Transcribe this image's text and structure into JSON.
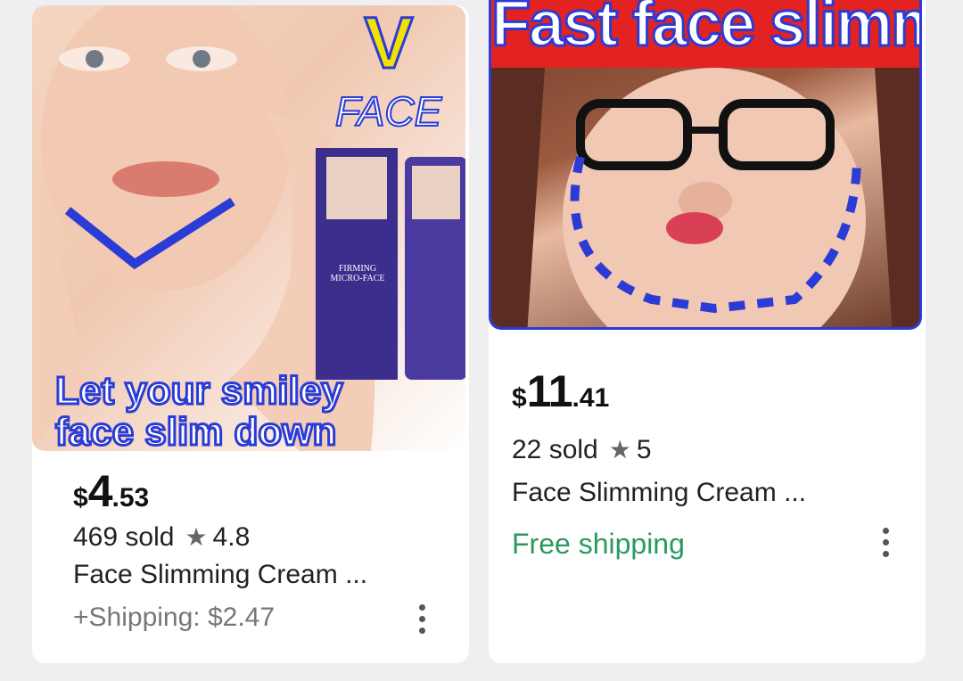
{
  "products": [
    {
      "image_text": {
        "letter": "V",
        "word": "FACE",
        "tagline_line1": "Let your smiley",
        "tagline_line2": "face slim down",
        "box_line1": "FIRMING",
        "box_line2": "MICRO-FACE"
      },
      "price_currency": "$",
      "price_whole": "4",
      "price_fraction": ".53",
      "sold": "469 sold",
      "rating": "4.8",
      "title": "Face Slimming Cream ...",
      "shipping": "+Shipping: $2.47"
    },
    {
      "image_text": {
        "banner": "Fast face slimming"
      },
      "price_currency": "$",
      "price_whole": "11",
      "price_fraction": ".41",
      "sold": "22 sold",
      "rating": "5",
      "title": "Face Slimming Cream ...",
      "shipping": "Free shipping"
    }
  ],
  "colors": {
    "free_shipping": "#2a9a61",
    "banner_blue": "#2b3bd6",
    "banner_red": "#e32222"
  },
  "icons": [
    "star-icon",
    "more-options-icon"
  ]
}
